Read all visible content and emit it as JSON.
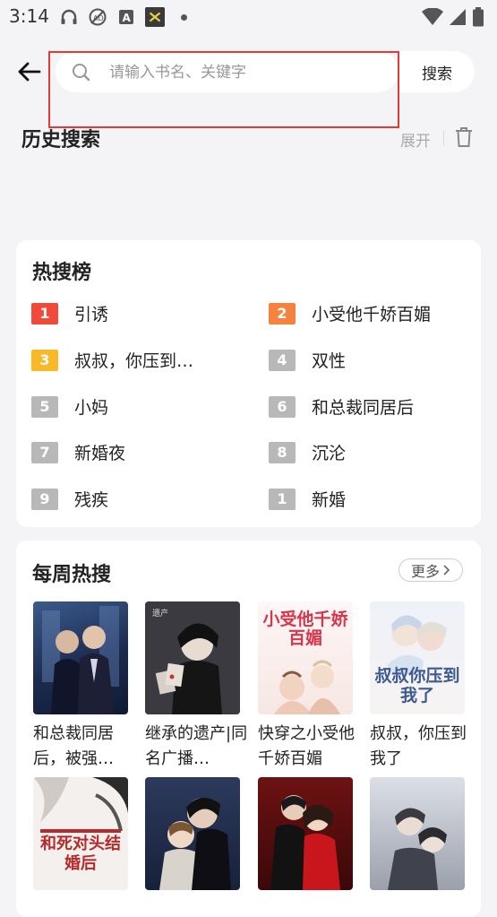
{
  "status_bar": {
    "time": "3:14"
  },
  "search": {
    "placeholder": "请输入书名、关键字",
    "button_label": "搜索"
  },
  "history": {
    "title": "历史搜索",
    "expand_label": "展开"
  },
  "hot_list": {
    "title": "热搜榜",
    "items": [
      {
        "rank": "1",
        "label": "引诱",
        "color": "#f04a3a"
      },
      {
        "rank": "2",
        "label": "小受他千娇百媚",
        "color": "#f5823e"
      },
      {
        "rank": "3",
        "label": "叔叔，你压到…",
        "color": "#f7b928"
      },
      {
        "rank": "4",
        "label": "双性",
        "color": "#b8b8b8"
      },
      {
        "rank": "5",
        "label": "小妈",
        "color": "#b8b8b8"
      },
      {
        "rank": "6",
        "label": "和总裁同居后",
        "color": "#b8b8b8"
      },
      {
        "rank": "7",
        "label": "新婚夜",
        "color": "#b8b8b8"
      },
      {
        "rank": "8",
        "label": "沉沦",
        "color": "#b8b8b8"
      },
      {
        "rank": "9",
        "label": "残疾",
        "color": "#b8b8b8"
      },
      {
        "rank": "1",
        "label": "新婚",
        "color": "#b8b8b8"
      }
    ]
  },
  "weekly": {
    "title": "每周热搜",
    "more_label": "更多",
    "books": [
      {
        "title": "和总裁同居后，被强…"
      },
      {
        "title": "继承的遗产|同名广播…"
      },
      {
        "title": "快穿之小受他千娇百媚",
        "cover_text": "小受他千娇百媚"
      },
      {
        "title": "叔叔，你压到我了",
        "cover_text": "叔叔你压到我了"
      },
      {
        "title": "",
        "cover_text": "和死对头结婚后"
      },
      {
        "title": ""
      },
      {
        "title": ""
      },
      {
        "title": ""
      }
    ]
  }
}
